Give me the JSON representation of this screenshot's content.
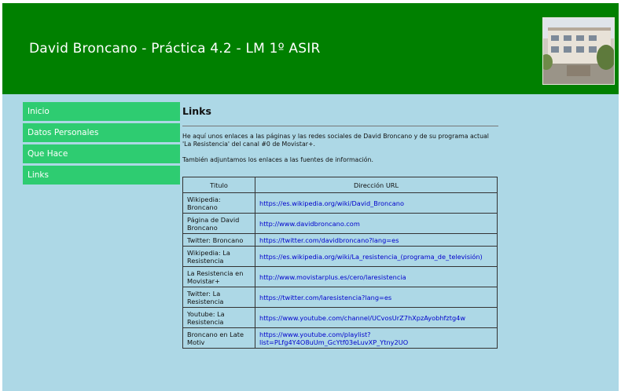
{
  "header": {
    "title": "David Broncano - Práctica 4.2 - LM 1º ASIR",
    "photo_icon": "building-photo"
  },
  "nav": {
    "items": [
      {
        "label": "Inicio"
      },
      {
        "label": "Datos Personales"
      },
      {
        "label": "Que Hace"
      },
      {
        "label": "Links"
      }
    ]
  },
  "main": {
    "heading": "Links",
    "intro": "He aquí unos enlaces a las páginas y las redes sociales de David Broncano y de su programa actual 'La Resistencia' del canal #0 de Movistar+.",
    "sources_note": "También adjuntamos los enlaces a las fuentes de información.",
    "table": {
      "headers": [
        "Titulo",
        "Dirección URL"
      ],
      "rows": [
        {
          "title": "Wikipedia: Broncano",
          "url": "https://es.wikipedia.org/wiki/David_Broncano"
        },
        {
          "title": "Página de David Broncano",
          "url": "http://www.davidbroncano.com"
        },
        {
          "title": "Twitter: Broncano",
          "url": "https://twitter.com/davidbroncano?lang=es"
        },
        {
          "title": "Wikipedia: La Resistencia",
          "url": "https://es.wikipedia.org/wiki/La_resistencia_(programa_de_televisión)"
        },
        {
          "title": "La Resistencia en Movistar+",
          "url": "http://www.movistarplus.es/cero/laresistencia"
        },
        {
          "title": "Twitter: La Resistencia",
          "url": "https://twitter.com/laresistencia?lang=es"
        },
        {
          "title": "Youtube: La Resistencia",
          "url": "https://www.youtube.com/channel/UCvosUrZ7hXpzAyobhfztg4w"
        },
        {
          "title": "Broncano en Late Motiv",
          "url": "https://www.youtube.com/playlist?list=PLfg4Y4O8uUm_GcYtf03eLuvXP_Ytny2UO"
        }
      ]
    }
  },
  "colors": {
    "header_bg": "#008000",
    "page_bg": "#add8e6",
    "nav_bg": "#2ecc71",
    "link": "#0000cc"
  }
}
